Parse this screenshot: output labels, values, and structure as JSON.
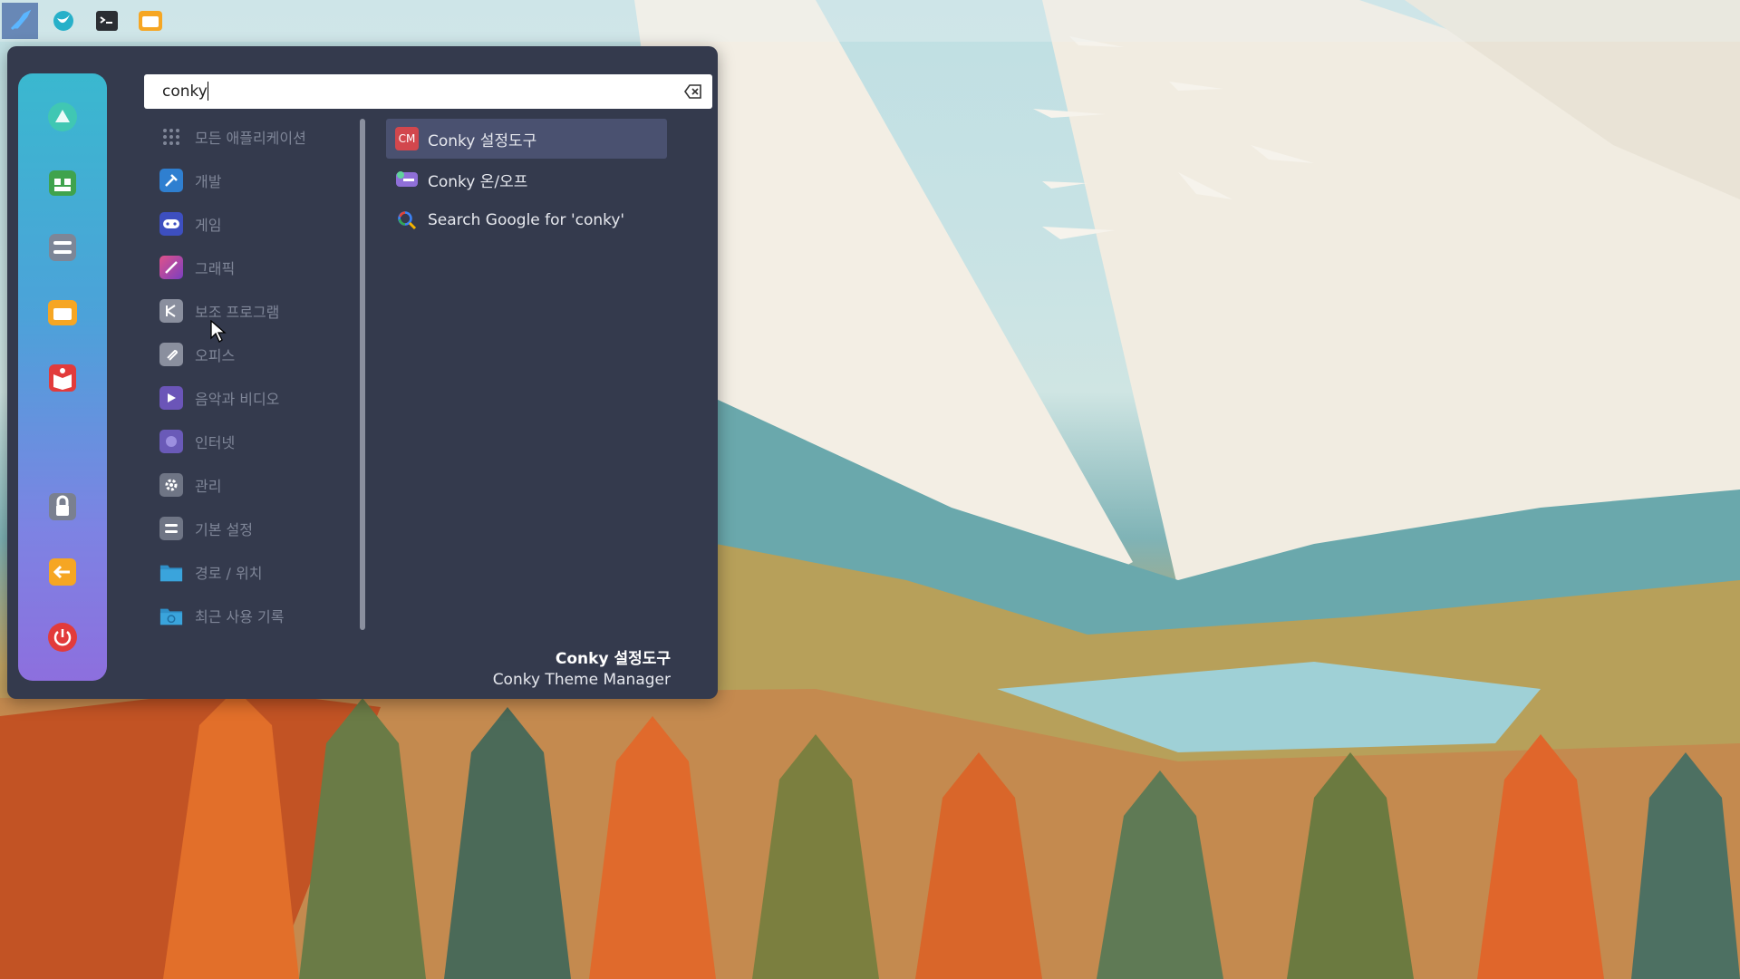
{
  "taskbar": {
    "launchers": [
      {
        "icon": "menu-rocket-icon"
      },
      {
        "icon": "browser-icon"
      },
      {
        "icon": "terminal-icon"
      },
      {
        "icon": "folder-icon"
      }
    ]
  },
  "favorites": [
    {
      "icon": "software-center-icon"
    },
    {
      "icon": "package-manager-icon"
    },
    {
      "icon": "settings-toggle-icon"
    },
    {
      "icon": "files-folder-icon"
    },
    {
      "icon": "help-book-icon"
    },
    {
      "icon": "lock-screen-icon"
    },
    {
      "icon": "logout-icon"
    },
    {
      "icon": "power-icon"
    }
  ],
  "search": {
    "value": "conky"
  },
  "categories": [
    {
      "label": "모든 애플리케이션",
      "icon": "all-apps-icon",
      "color": "#343a4d"
    },
    {
      "label": "개발",
      "icon": "development-icon",
      "color": "#2f7fd0"
    },
    {
      "label": "게임",
      "icon": "games-icon",
      "color": "#3d4fc0"
    },
    {
      "label": "그래픽",
      "icon": "graphics-icon",
      "color": "#9a3fb6"
    },
    {
      "label": "보조 프로그램",
      "icon": "accessories-icon",
      "color": "#8a8f9e"
    },
    {
      "label": "오피스",
      "icon": "office-icon",
      "color": "#8a8f9e"
    },
    {
      "label": "음악과 비디오",
      "icon": "multimedia-icon",
      "color": "#6b55b8"
    },
    {
      "label": "인터넷",
      "icon": "internet-icon",
      "color": "#6a5ab8"
    },
    {
      "label": "관리",
      "icon": "administration-icon",
      "color": "#6f7585"
    },
    {
      "label": "기본 설정",
      "icon": "preferences-icon",
      "color": "#6f7585"
    },
    {
      "label": "경로 / 위치",
      "icon": "places-folder-icon",
      "color": "#2f8fc8"
    },
    {
      "label": "최근 사용 기록",
      "icon": "recent-folder-icon",
      "color": "#2f8fc8"
    }
  ],
  "results": [
    {
      "label": "Conky 설정도구",
      "icon": "conky-manager-icon",
      "icon_text": "CM"
    },
    {
      "label": "Conky 온/오프",
      "icon": "conky-toggle-icon"
    },
    {
      "label": "Search Google for 'conky'",
      "icon": "google-search-icon"
    }
  ],
  "info": {
    "title": "Conky 설정도구",
    "description": "Conky Theme Manager"
  },
  "colors": {
    "menu_bg": "#343a4d",
    "selection": "#4a5170",
    "category_text": "#7f8698"
  }
}
